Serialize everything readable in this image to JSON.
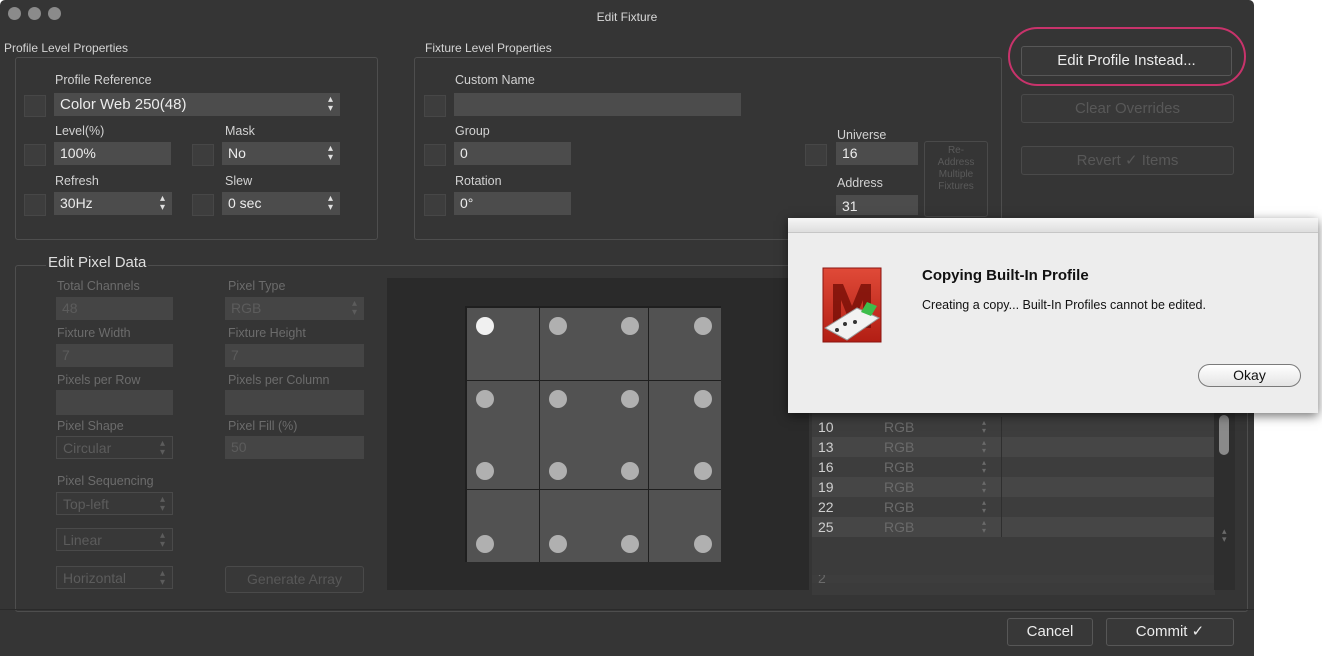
{
  "window": {
    "title": "Edit Fixture"
  },
  "profile_props": {
    "group_title": "Profile Level Properties",
    "profile_reference_label": "Profile Reference",
    "profile_reference_value": "Color Web 250(48)",
    "level_label": "Level(%)",
    "level_value": "100%",
    "mask_label": "Mask",
    "mask_value": "No",
    "refresh_label": "Refresh",
    "refresh_value": "30Hz",
    "slew_label": "Slew",
    "slew_value": "0 sec"
  },
  "fixture_props": {
    "group_title": "Fixture Level Properties",
    "custom_name_label": "Custom Name",
    "custom_name_value": "",
    "group_label": "Group",
    "group_value": "0",
    "rotation_label": "Rotation",
    "rotation_value": "0°",
    "universe_label": "Universe",
    "universe_value": "16",
    "address_label": "Address",
    "address_value": "31",
    "readdress_line1": "Re-",
    "readdress_line2": "Address",
    "readdress_line3": "Multiple",
    "readdress_line4": "Fixtures"
  },
  "actions": {
    "edit_profile": "Edit Profile Instead...",
    "clear_overrides": "Clear Overrides",
    "revert_items": "Revert ✓ Items",
    "cancel": "Cancel",
    "commit": "Commit ✓"
  },
  "pixel_data": {
    "title": "Edit Pixel Data",
    "total_channels_label": "Total Channels",
    "total_channels_value": "48",
    "pixel_type_label": "Pixel Type",
    "pixel_type_value": "RGB",
    "fixture_width_label": "Fixture Width",
    "fixture_width_value": "7",
    "fixture_height_label": "Fixture Height",
    "fixture_height_value": "7",
    "pixels_per_row_label": "Pixels per Row",
    "pixels_per_row_value": "",
    "pixels_per_column_label": "Pixels per Column",
    "pixels_per_column_value": "",
    "pixel_shape_label": "Pixel Shape",
    "pixel_shape_value": "Circular",
    "pixel_fill_label": "Pixel Fill (%)",
    "pixel_fill_value": "50",
    "pixel_sequencing_label": "Pixel Sequencing",
    "sequencing_start": "Top-left",
    "sequencing_mode": "Linear",
    "sequencing_direction": "Horizontal",
    "generate_array": "Generate Array"
  },
  "channel_rows": [
    {
      "channel": "10",
      "type": "RGB"
    },
    {
      "channel": "13",
      "type": "RGB"
    },
    {
      "channel": "16",
      "type": "RGB"
    },
    {
      "channel": "19",
      "type": "RGB"
    },
    {
      "channel": "22",
      "type": "RGB"
    },
    {
      "channel": "25",
      "type": "RGB"
    }
  ],
  "dialog": {
    "title": "Copying Built-In Profile",
    "message": "Creating a copy... Built-In Profiles cannot be edited.",
    "ok": "Okay",
    "app_icon": "m-app-icon"
  },
  "colors": {
    "highlight_ring": "#c8336b",
    "window_bg": "#353535",
    "dialog_bg": "#ededed"
  }
}
